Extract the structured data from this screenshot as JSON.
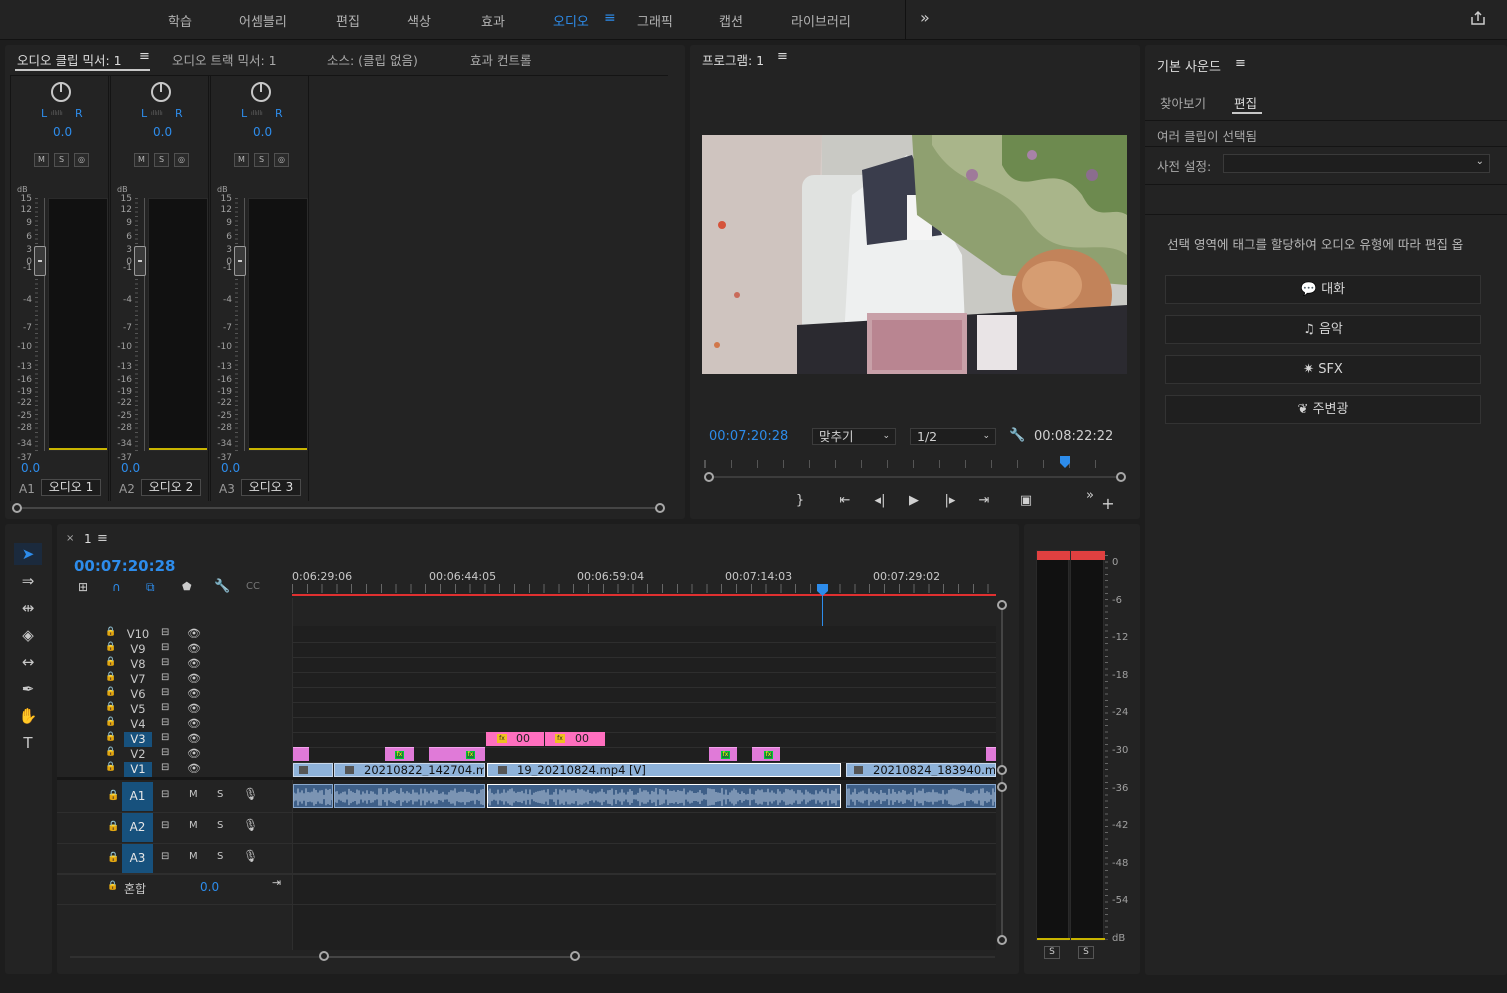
{
  "workspaces": [
    "학습",
    "어셈블리",
    "편집",
    "색상",
    "효과",
    "오디오",
    "그래픽",
    "캡션",
    "라이브러리"
  ],
  "active_workspace_menu": "≡",
  "more": "»",
  "mixer": {
    "tabs": [
      "오디오 클립 믹서: 1",
      "오디오 트랙 믹서: 1",
      "소스: (클립 없음)",
      "효과 컨트롤"
    ],
    "menu": "≡",
    "channels": [
      {
        "pan": "0.0",
        "vol": "0.0",
        "id": "A1",
        "name": "오디오 1"
      },
      {
        "pan": "0.0",
        "vol": "0.0",
        "id": "A2",
        "name": "오디오 2"
      },
      {
        "pan": "0.0",
        "vol": "0.0",
        "id": "A3",
        "name": "오디오 3"
      }
    ],
    "L": "L",
    "R": "R",
    "M": "M",
    "S": "S",
    "db": "dB",
    "scale": [
      "15",
      "12",
      "9",
      "6",
      "3",
      "0",
      "-1",
      "-4",
      "-7",
      "-10",
      "-13",
      "-16",
      "-19",
      "-22",
      "-25",
      "-28",
      "-34",
      "-37"
    ]
  },
  "program": {
    "title": "프로그램: 1",
    "timecode": "00:07:20:28",
    "fit": "맞추기",
    "resolution": "1/2",
    "duration": "00:08:22:22",
    "playhead_fraction": 0.87
  },
  "essential_sound": {
    "title": "기본 사운드",
    "tabs": [
      "찾아보기",
      "편집"
    ],
    "status": "여러 클립이 선택됨",
    "preset_label": "사전 설정:",
    "hint": "선택 영역에 태그를 할당하여 오디오 유형에 따라 편집 옵",
    "buttons": [
      "대화",
      "음악",
      "SFX",
      "주변광"
    ]
  },
  "timeline": {
    "sequence": "1",
    "timecode": "00:07:20:28",
    "ruler": [
      "0:06:29:06",
      "00:06:44:05",
      "00:06:59:04",
      "00:07:14:03",
      "00:07:29:02"
    ],
    "video_tracks": [
      "V10",
      "V9",
      "V8",
      "V7",
      "V6",
      "V5",
      "V4",
      "V3",
      "V2",
      "V1"
    ],
    "audio_tracks": [
      "A1",
      "A2",
      "A3"
    ],
    "mix_label": "혼합",
    "mix_value": "0.0",
    "clips": {
      "v3_a": "00",
      "v3_b": "00",
      "v1_a": "20210822_142704.m",
      "v1_b": "19_20210824.mp4 [V]",
      "v1_c": "20210824_183940.m"
    }
  },
  "meters": {
    "scale": [
      "0",
      "-6",
      "-12",
      "-18",
      "-24",
      "-30",
      "-36",
      "-42",
      "-48",
      "-54",
      "dB"
    ],
    "solo": [
      "S",
      "S"
    ]
  },
  "colors": {
    "accent": "#2d8ceb",
    "selected_track": "#17517d",
    "video_clip": "#8eb2d9",
    "audio_clip": "#3e5f88",
    "adjust_clip": "#e07ad8",
    "playhead": "#2d8ceb"
  }
}
